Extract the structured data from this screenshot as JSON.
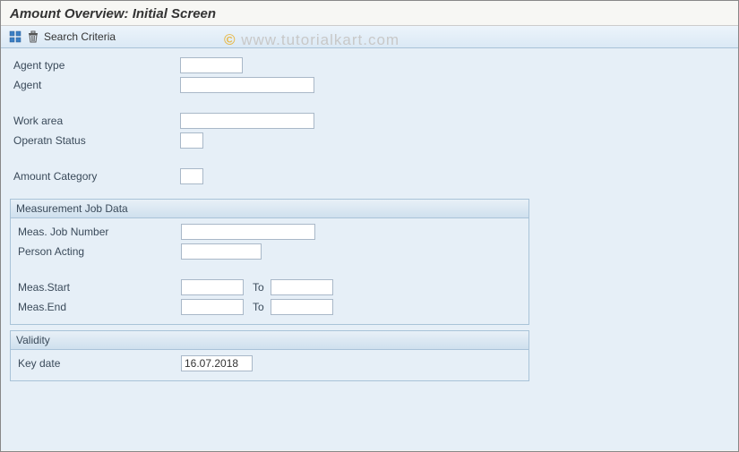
{
  "title": "Amount Overview: Initial Screen",
  "toolbar": {
    "grid_icon": "grid-icon",
    "trash_icon": "trash-icon",
    "search_criteria_label": "Search Criteria"
  },
  "fields": {
    "agent_type": {
      "label": "Agent type",
      "value": ""
    },
    "agent": {
      "label": "Agent",
      "value": ""
    },
    "work_area": {
      "label": "Work area",
      "value": ""
    },
    "operatn_status": {
      "label": "Operatn Status",
      "value": ""
    },
    "amount_category": {
      "label": "Amount Category",
      "value": ""
    }
  },
  "measurement_group": {
    "title": "Measurement Job Data",
    "meas_job_number": {
      "label": "Meas. Job Number",
      "value": ""
    },
    "person_acting": {
      "label": "Person Acting",
      "value": ""
    },
    "meas_start": {
      "label": "Meas.Start",
      "from": "",
      "to_label": "To",
      "to": ""
    },
    "meas_end": {
      "label": "Meas.End",
      "from": "",
      "to_label": "To",
      "to": ""
    }
  },
  "validity_group": {
    "title": "Validity",
    "key_date": {
      "label": "Key date",
      "value": "16.07.2018"
    }
  },
  "watermark": {
    "copy": "©",
    "text": " www.tutorialkart.com"
  }
}
